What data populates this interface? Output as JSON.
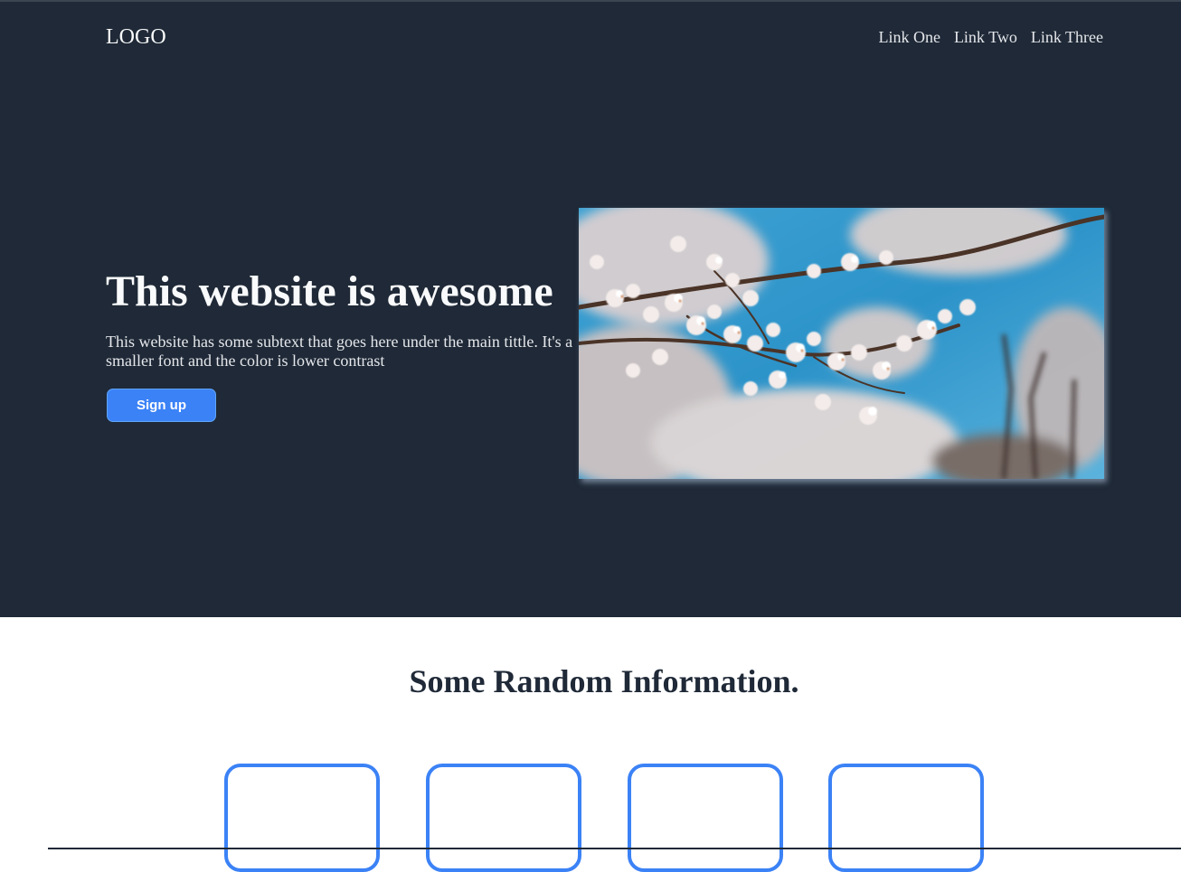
{
  "header": {
    "logo": "LOGO",
    "nav": [
      "Link One",
      "Link Two",
      "Link Three"
    ]
  },
  "hero": {
    "title": "This website is awesome",
    "subtitle": "This website has some subtext that goes here under the main tittle. It's a smaller font and the color is lower contrast",
    "cta_label": "Sign up",
    "image_alt": "cherry blossom photo"
  },
  "info": {
    "title": "Some Random Information.",
    "cards": [
      "",
      "",
      "",
      ""
    ]
  },
  "colors": {
    "hero_bg": "#1f2937",
    "accent": "#3b82f6",
    "page_bg": "#ffffff"
  }
}
